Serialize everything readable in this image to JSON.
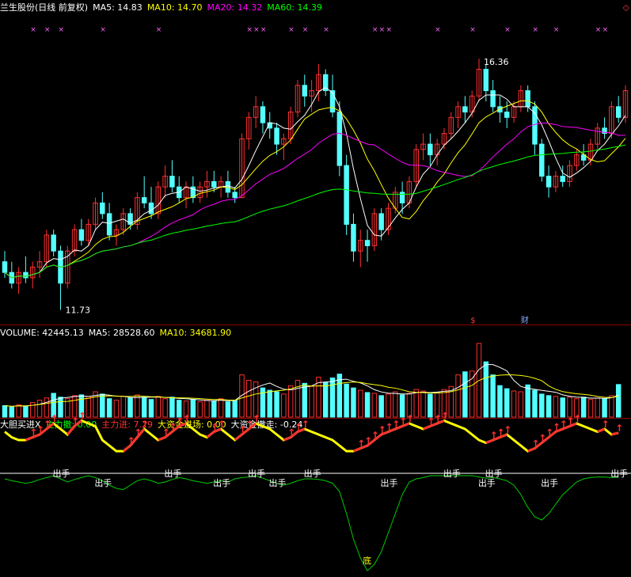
{
  "header": {
    "stock_title": "兰生股份(日线 前复权)",
    "ma5": "MA5: 14.83",
    "ma10": "MA10: 14.70",
    "ma20": "MA20: 14.32",
    "ma60": "MA60: 14.39",
    "corner_icon": "diamond-icon"
  },
  "volume_header": {
    "label": "VOLUME: 42445.13",
    "ma5": "MA5: 28528.60",
    "ma10": "MA10: 34681.90"
  },
  "indicator_header": {
    "name": "大胆买进X",
    "main_out": "主力撤: 0.00",
    "main_in": "主力进: 7.29",
    "big_in": "大资金进场: 0.00",
    "big_out": "大资金撤走: -0.24"
  },
  "colors": {
    "up": "#ff3030",
    "down": "#54ffff",
    "ma5": "#ffffff",
    "ma10": "#ffff00",
    "ma20": "#ff00ff",
    "ma60": "#00ff00",
    "axis": "#8b0000"
  },
  "chart_data": [
    {
      "type": "candlestick",
      "title": "兰生股份(日线 前复权)",
      "annotations": {
        "high": "16.36",
        "low": "11.73",
        "event_marks": [
          "$",
          "财"
        ]
      },
      "marker_glyph": "×",
      "ylim": [
        11.5,
        17.2
      ],
      "ohlc": [
        [
          12.6,
          12.8,
          12.3,
          12.4
        ],
        [
          12.4,
          12.6,
          12.1,
          12.2
        ],
        [
          12.2,
          12.5,
          12.0,
          12.4
        ],
        [
          12.4,
          12.7,
          12.2,
          12.3
        ],
        [
          12.3,
          12.6,
          12.1,
          12.5
        ],
        [
          12.5,
          12.8,
          12.3,
          12.6
        ],
        [
          12.6,
          13.2,
          12.5,
          13.1
        ],
        [
          13.1,
          13.2,
          12.7,
          12.8
        ],
        [
          12.8,
          12.9,
          11.7,
          12.2
        ],
        [
          12.2,
          12.9,
          12.1,
          12.8
        ],
        [
          12.8,
          13.3,
          12.7,
          13.2
        ],
        [
          13.2,
          13.4,
          12.9,
          13.0
        ],
        [
          13.0,
          13.4,
          12.9,
          13.3
        ],
        [
          13.3,
          13.8,
          13.2,
          13.7
        ],
        [
          13.7,
          13.9,
          13.4,
          13.5
        ],
        [
          13.5,
          13.7,
          13.0,
          13.1
        ],
        [
          13.1,
          13.3,
          12.9,
          13.2
        ],
        [
          13.2,
          13.6,
          13.1,
          13.5
        ],
        [
          13.5,
          13.6,
          13.2,
          13.3
        ],
        [
          13.3,
          13.9,
          13.2,
          13.8
        ],
        [
          13.8,
          14.2,
          13.6,
          13.7
        ],
        [
          13.7,
          14.0,
          13.4,
          13.5
        ],
        [
          13.5,
          14.1,
          13.4,
          14.0
        ],
        [
          14.0,
          14.4,
          13.8,
          14.2
        ],
        [
          14.2,
          14.5,
          13.9,
          14.0
        ],
        [
          14.0,
          14.2,
          13.7,
          13.8
        ],
        [
          13.8,
          14.1,
          13.6,
          14.0
        ],
        [
          14.0,
          14.2,
          13.7,
          13.8
        ],
        [
          13.8,
          14.1,
          13.7,
          14.0
        ],
        [
          14.0,
          14.3,
          13.8,
          14.1
        ],
        [
          14.1,
          14.3,
          13.9,
          14.0
        ],
        [
          14.0,
          14.2,
          13.8,
          14.1
        ],
        [
          14.1,
          14.3,
          13.8,
          13.9
        ],
        [
          13.9,
          14.0,
          13.7,
          13.8
        ],
        [
          13.8,
          15.0,
          13.8,
          14.9
        ],
        [
          14.9,
          15.4,
          14.7,
          15.3
        ],
        [
          15.3,
          15.7,
          15.1,
          15.5
        ],
        [
          15.5,
          15.6,
          15.0,
          15.2
        ],
        [
          15.2,
          15.4,
          14.9,
          15.1
        ],
        [
          15.1,
          15.2,
          14.6,
          14.8
        ],
        [
          14.8,
          15.0,
          14.5,
          14.9
        ],
        [
          14.9,
          15.5,
          14.8,
          15.4
        ],
        [
          15.4,
          16.0,
          15.3,
          15.9
        ],
        [
          15.9,
          16.1,
          15.5,
          15.7
        ],
        [
          15.7,
          16.0,
          15.4,
          15.8
        ],
        [
          15.8,
          16.3,
          15.6,
          16.1
        ],
        [
          16.1,
          16.2,
          15.7,
          15.8
        ],
        [
          15.8,
          16.1,
          15.3,
          15.4
        ],
        [
          15.4,
          15.6,
          14.2,
          14.4
        ],
        [
          14.4,
          14.6,
          13.1,
          13.3
        ],
        [
          13.3,
          13.5,
          12.6,
          12.8
        ],
        [
          12.8,
          13.2,
          12.5,
          13.0
        ],
        [
          13.0,
          13.2,
          12.6,
          12.9
        ],
        [
          12.9,
          13.6,
          12.8,
          13.5
        ],
        [
          13.5,
          13.6,
          13.0,
          13.2
        ],
        [
          13.2,
          13.7,
          13.1,
          13.6
        ],
        [
          13.6,
          14.0,
          13.5,
          13.9
        ],
        [
          13.9,
          14.1,
          13.5,
          13.7
        ],
        [
          13.7,
          14.2,
          13.6,
          14.1
        ],
        [
          14.1,
          14.8,
          14.0,
          14.7
        ],
        [
          14.7,
          15.0,
          14.5,
          14.8
        ],
        [
          14.8,
          15.0,
          14.4,
          14.6
        ],
        [
          14.6,
          14.9,
          14.4,
          14.8
        ],
        [
          14.8,
          15.1,
          14.7,
          15.0
        ],
        [
          15.0,
          15.4,
          14.9,
          15.3
        ],
        [
          15.3,
          15.6,
          15.1,
          15.5
        ],
        [
          15.5,
          15.7,
          15.2,
          15.4
        ],
        [
          15.4,
          15.8,
          15.3,
          15.7
        ],
        [
          15.7,
          16.4,
          15.6,
          16.2
        ],
        [
          16.2,
          16.3,
          15.6,
          15.8
        ],
        [
          15.8,
          16.0,
          15.4,
          15.5
        ],
        [
          15.5,
          15.7,
          15.2,
          15.4
        ],
        [
          15.4,
          15.6,
          15.1,
          15.3
        ],
        [
          15.3,
          15.6,
          15.2,
          15.5
        ],
        [
          15.5,
          15.9,
          15.4,
          15.8
        ],
        [
          15.8,
          15.9,
          15.4,
          15.5
        ],
        [
          15.5,
          15.6,
          14.6,
          14.8
        ],
        [
          14.8,
          14.9,
          14.1,
          14.2
        ],
        [
          14.2,
          14.4,
          13.8,
          14.0
        ],
        [
          14.0,
          14.3,
          13.9,
          14.2
        ],
        [
          14.2,
          14.4,
          14.0,
          14.1
        ],
        [
          14.1,
          14.5,
          14.0,
          14.4
        ],
        [
          14.4,
          14.7,
          14.3,
          14.6
        ],
        [
          14.6,
          14.8,
          14.4,
          14.5
        ],
        [
          14.5,
          14.9,
          14.4,
          14.8
        ],
        [
          14.8,
          15.2,
          14.7,
          15.1
        ],
        [
          15.1,
          15.3,
          14.9,
          15.0
        ],
        [
          15.0,
          15.6,
          14.9,
          15.5
        ],
        [
          15.5,
          15.7,
          15.2,
          15.3
        ],
        [
          15.3,
          15.9,
          15.2,
          15.8
        ]
      ]
    },
    {
      "type": "bar",
      "title": "VOLUME",
      "ylim": [
        0,
        100000
      ],
      "values": [
        15000,
        13000,
        16000,
        14000,
        19000,
        22000,
        25000,
        31000,
        26000,
        24000,
        28000,
        29000,
        27000,
        33000,
        30000,
        24000,
        22000,
        27000,
        25000,
        29000,
        26000,
        23000,
        27000,
        24000,
        26000,
        22000,
        21000,
        23000,
        20000,
        22000,
        21000,
        24000,
        20000,
        22000,
        55000,
        48000,
        46000,
        38000,
        35000,
        33000,
        30000,
        41000,
        48000,
        44000,
        40000,
        52000,
        45000,
        51000,
        56000,
        43000,
        38000,
        35000,
        32000,
        31000,
        28000,
        30000,
        33000,
        29000,
        31000,
        36000,
        34000,
        30000,
        32000,
        36000,
        40000,
        55000,
        59000,
        60000,
        96000,
        72000,
        55000,
        41000,
        37000,
        34000,
        33000,
        42000,
        35000,
        30000,
        28000,
        27000,
        25000,
        26000,
        24000,
        26000,
        23000,
        25000,
        24000,
        28000,
        42445
      ]
    },
    {
      "type": "line",
      "title": "大胆买进X",
      "labels": {
        "signal": "出手",
        "bottom": "底",
        "arrow": "↑"
      },
      "series": [
        {
          "name": "主力进",
          "values": [
            7.5,
            6.5,
            6,
            6,
            6.5,
            7,
            8,
            9,
            8,
            7,
            8.5,
            9.5,
            9,
            8.5,
            6,
            5,
            4,
            4,
            5,
            6.5,
            8,
            7,
            6,
            6.5,
            7.5,
            8.5,
            9,
            8,
            7,
            6.5,
            7.5,
            8,
            7,
            6,
            7,
            8,
            9,
            8.5,
            8,
            7,
            6,
            6.5,
            7.5,
            8,
            7.5,
            7,
            6.5,
            6,
            5,
            4,
            4,
            4.5,
            5,
            6,
            7,
            7.5,
            8,
            8.5,
            9,
            8.5,
            8,
            8.5,
            9,
            9.5,
            9,
            8.5,
            8,
            7,
            6,
            5.5,
            6,
            6.5,
            7,
            6,
            5,
            4,
            4.5,
            5.5,
            6.5,
            7.5,
            8,
            8.5,
            9,
            8.5,
            8,
            7.5,
            8,
            7,
            7.3
          ]
        },
        {
          "name": "大资金进场",
          "values": [
            0,
            0,
            0,
            0,
            0,
            0,
            0,
            0,
            0,
            0,
            0,
            0,
            0,
            0,
            0,
            0,
            0,
            0,
            0,
            0,
            0,
            0,
            0,
            0,
            0,
            0,
            0,
            0,
            0,
            0,
            0,
            0,
            0,
            0,
            0,
            0,
            0,
            0,
            0,
            0,
            0,
            0,
            0,
            0,
            0,
            0,
            0,
            0,
            0,
            0,
            0,
            0,
            0,
            0,
            0,
            0,
            0,
            0,
            0,
            0,
            0,
            0,
            0,
            0,
            0,
            0,
            0,
            0,
            0,
            0,
            0,
            0,
            0,
            0,
            0,
            0,
            0,
            0,
            0,
            0,
            0,
            0,
            0,
            0,
            0,
            0,
            0,
            0,
            0
          ]
        },
        {
          "name": "大资金撤走",
          "values": [
            -0.5,
            -0.8,
            -1,
            -1.2,
            -1,
            -0.6,
            -0.3,
            0,
            -0.5,
            -1,
            -0.6,
            -0.3,
            0,
            -0.3,
            -0.8,
            -1.5,
            -2,
            -2.2,
            -1.5,
            -0.8,
            -0.5,
            -0.8,
            -1.2,
            -1,
            -0.6,
            -0.3,
            -0.5,
            -0.8,
            -1,
            -1.2,
            -1,
            -0.8,
            -1,
            -0.5,
            -0.3,
            -0.2,
            0,
            -0.4,
            -0.8,
            -1.2,
            -1.5,
            -1.2,
            -0.8,
            -0.5,
            -0.5,
            -0.6,
            -0.8,
            -1.2,
            -2.5,
            -6,
            -10,
            -13,
            -15,
            -14,
            -12,
            -9,
            -6,
            -3,
            -1,
            -0.5,
            -0.3,
            0,
            0,
            0,
            0,
            0,
            0,
            0,
            -0.2,
            -0.4,
            -0.3,
            -0.5,
            -0.8,
            -1.5,
            -3,
            -5,
            -6.5,
            -7,
            -6,
            -4.5,
            -3,
            -2,
            -1,
            -0.5,
            -0.3,
            -0.2,
            -0.2,
            -0.3,
            -0.24
          ]
        }
      ]
    }
  ]
}
